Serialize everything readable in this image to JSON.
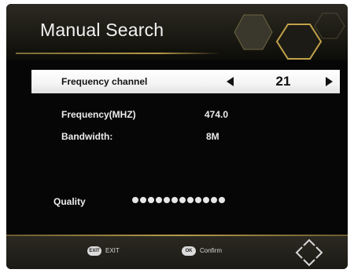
{
  "header": {
    "title": "Manual Search"
  },
  "channel_selector": {
    "label": "Frequency channel",
    "value": "21"
  },
  "info": {
    "frequency_label": "Frequency(MHZ)",
    "frequency_value": "474.0",
    "bandwidth_label": "Bandwidth:",
    "bandwidth_value": "8M",
    "quality_label": "Quality",
    "quality_dot_count": 12
  },
  "footer": {
    "exit_key": "EXIT",
    "exit_label": "EXIT",
    "confirm_key": "OK",
    "confirm_label": "Confirm"
  },
  "colors": {
    "background": "#060606",
    "accent_gold": "#b59a4a",
    "selected_row": "#ffffff",
    "text": "#ececec"
  },
  "icons": {
    "left": "left-arrow-icon",
    "right": "right-arrow-icon",
    "nav": "navigation-arrows-icon",
    "decoration": "hexagon-decoration-icon"
  }
}
